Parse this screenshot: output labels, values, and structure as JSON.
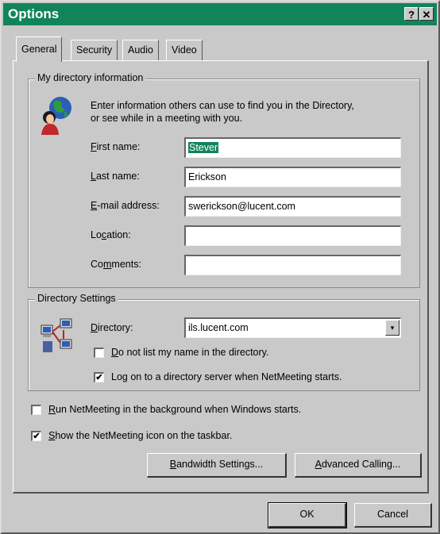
{
  "window": {
    "title": "Options",
    "help_glyph": "?",
    "close_glyph": "✕"
  },
  "tabs": [
    {
      "label": "General",
      "active": true
    },
    {
      "label": "Security",
      "active": false
    },
    {
      "label": "Audio",
      "active": false
    },
    {
      "label": "Video",
      "active": false
    }
  ],
  "directory_info": {
    "group_label": "My directory information",
    "description_line1": "Enter information others can use to find you in the Directory,",
    "description_line2": "or see while in a meeting with you.",
    "first_name": {
      "label_ul": "F",
      "label_rest": "irst name:",
      "value": "Stever"
    },
    "last_name": {
      "label_ul": "L",
      "label_rest": "ast name:",
      "value": "Erickson"
    },
    "email": {
      "label_ul": "E",
      "label_rest": "-mail address:",
      "value": "swerickson@lucent.com"
    },
    "location": {
      "label_pre": "Lo",
      "label_ul": "c",
      "label_rest": "ation:",
      "value": ""
    },
    "comments": {
      "label_pre": "Co",
      "label_ul": "m",
      "label_rest": "ments:",
      "value": ""
    }
  },
  "directory_settings": {
    "group_label": "Directory Settings",
    "directory_label_ul": "D",
    "directory_label_rest": "irectory:",
    "directory_value": "ils.lucent.com",
    "do_not_list": {
      "label_ul": "D",
      "label_rest": "o not list my name in the directory.",
      "checked": false
    },
    "log_on": {
      "label_pre": "Lo",
      "label_ul": "g",
      "label_rest": " on to a directory server when NetMeeting starts.",
      "checked": true
    }
  },
  "options": {
    "run_background": {
      "label_ul": "R",
      "label_rest": "un NetMeeting in the background when Windows starts.",
      "checked": false
    },
    "show_icon": {
      "label_ul": "S",
      "label_rest": "how the NetMeeting icon on the taskbar.",
      "checked": true
    }
  },
  "buttons": {
    "bandwidth_ul": "B",
    "bandwidth_rest": "andwidth Settings...",
    "advanced_ul": "A",
    "advanced_rest": "dvanced Calling...",
    "ok": "OK",
    "cancel": "Cancel"
  },
  "icons": {
    "person": "person-globe-icon",
    "network": "network-computers-icon",
    "check_mark": "✔",
    "dropdown_arrow": "▾"
  }
}
